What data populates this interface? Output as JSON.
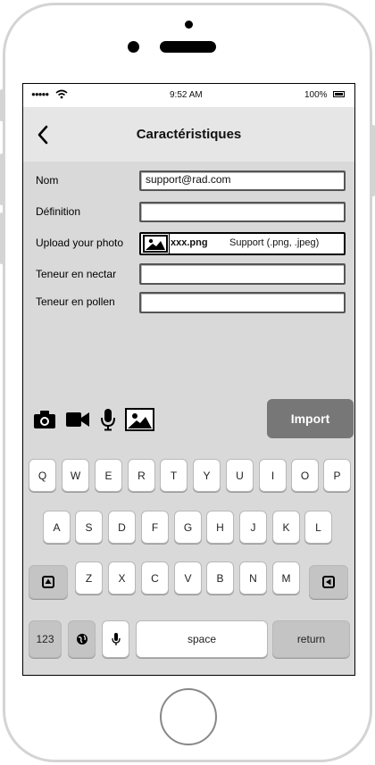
{
  "status": {
    "time": "9:52 AM",
    "battery": "100%"
  },
  "header": {
    "title": "Caractéristiques"
  },
  "form": {
    "nom": {
      "label": "Nom",
      "value": "support@rad.com"
    },
    "definition": {
      "label": "Définition",
      "value": ""
    },
    "photo": {
      "label": "Upload your photo",
      "filename": "xxx.png",
      "support": "Support (.png, .jpeg)"
    },
    "nectar": {
      "label": "Teneur en nectar",
      "value": ""
    },
    "pollen": {
      "label": "Teneur en pollen",
      "value": ""
    }
  },
  "media": {
    "icons": [
      "camera-icon",
      "video-icon",
      "microphone-icon",
      "image-icon"
    ]
  },
  "import_label": "Import",
  "keyboard": {
    "row1": [
      "Q",
      "W",
      "E",
      "R",
      "T",
      "Y",
      "U",
      "I",
      "O",
      "P"
    ],
    "row2": [
      "A",
      "S",
      "D",
      "F",
      "G",
      "H",
      "J",
      "K",
      "L"
    ],
    "row3": [
      "Z",
      "X",
      "C",
      "V",
      "B",
      "N",
      "M"
    ],
    "numbers": "123",
    "space": "space",
    "return": "return"
  }
}
